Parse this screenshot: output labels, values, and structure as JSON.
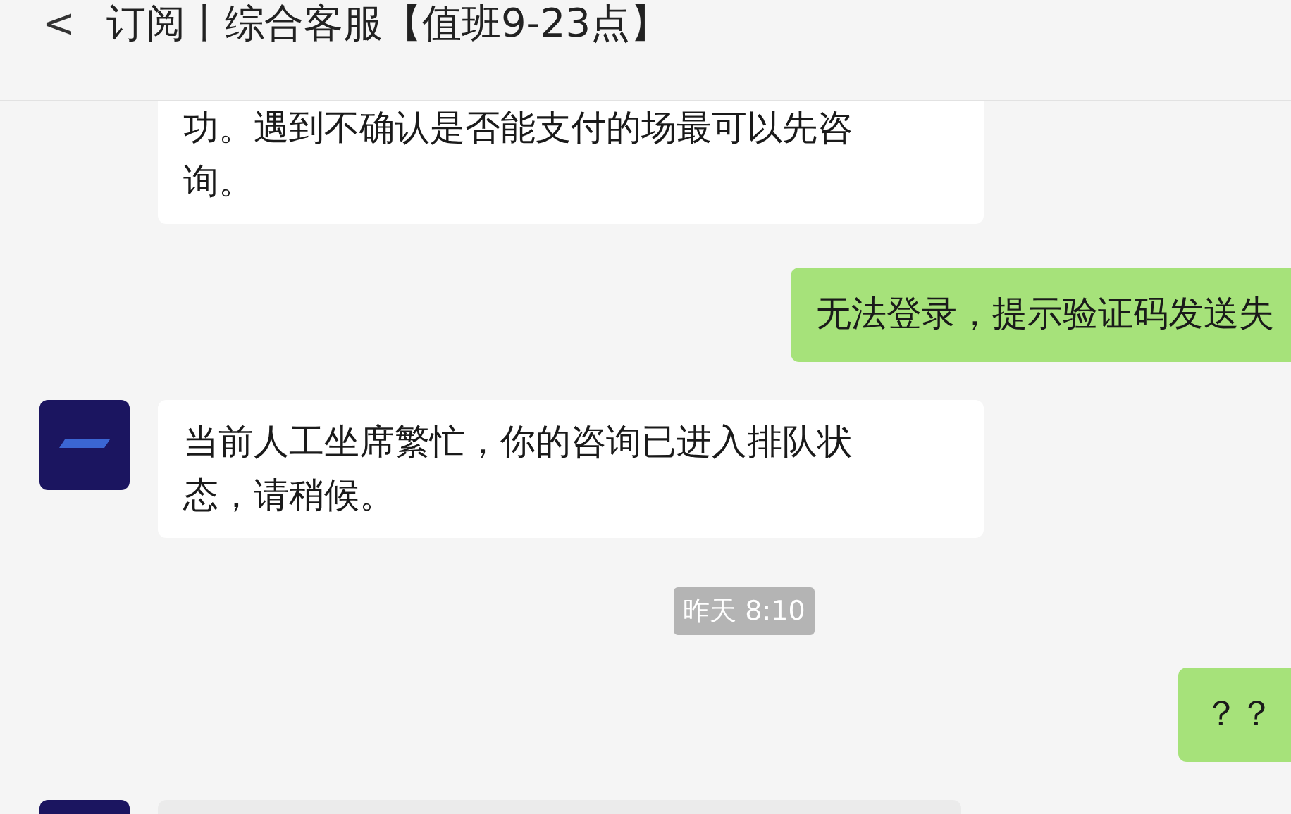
{
  "header": {
    "back_icon": "<",
    "title": "订阅丨综合客服【值班9-23点】"
  },
  "messages": [
    {
      "kind": "received",
      "avatar": false,
      "text": "功。遇到不确认是否能支付的场最可以先咨询。"
    },
    {
      "kind": "sent",
      "text": "无法登录，提示验证码发送失"
    },
    {
      "kind": "received",
      "avatar": true,
      "text": "当前人工坐席繁忙，你的咨询已进入排队状态，请稍候。"
    },
    {
      "kind": "time",
      "text": "昨天 8:10"
    },
    {
      "kind": "sent",
      "text": "？？"
    },
    {
      "kind": "received",
      "avatar": true
    }
  ]
}
